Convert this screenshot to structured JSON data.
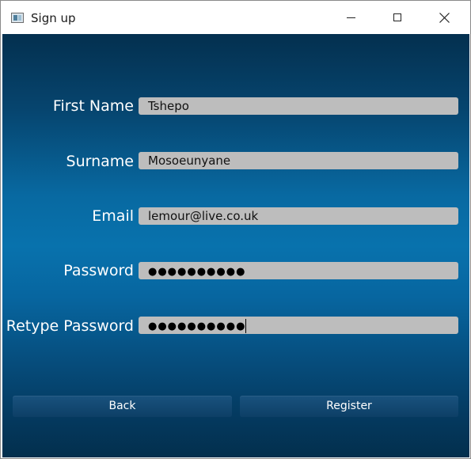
{
  "window": {
    "title": "Sign up"
  },
  "form": {
    "fields": [
      {
        "label": "First Name",
        "value": "Tshepo",
        "type": "text"
      },
      {
        "label": "Surname",
        "value": "Mosoeunyane",
        "type": "text"
      },
      {
        "label": "Email",
        "value": "lemour@live.co.uk",
        "type": "text"
      },
      {
        "label": "Password",
        "value": "●●●●●●●●●●",
        "type": "password"
      },
      {
        "label": "Retype Password",
        "value": "●●●●●●●●●●",
        "type": "password"
      }
    ]
  },
  "buttons": {
    "back_label": "Back",
    "register_label": "Register"
  },
  "colors": {
    "field_bg": "#bdbdbd",
    "button_bg": "#0d3f66",
    "background_mid": "#0872ad"
  }
}
